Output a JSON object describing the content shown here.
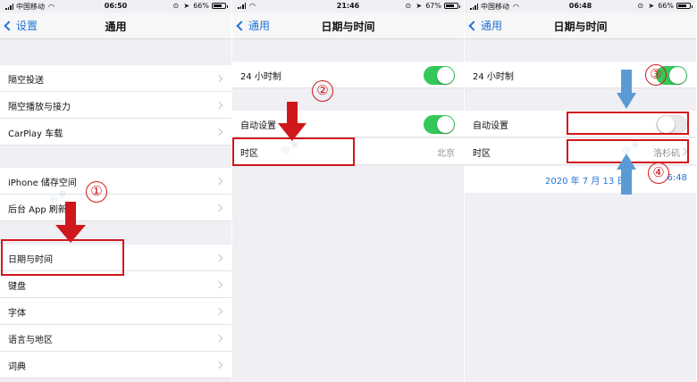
{
  "status_bars": [
    {
      "carrier": "中国移动",
      "time": "06:50",
      "battery": "66%",
      "battery_level": 0.66
    },
    {
      "carrier": "",
      "time": "21:46",
      "battery": "67%",
      "battery_level": 0.67
    },
    {
      "carrier": "中国移动",
      "time": "06:48",
      "battery": "66%",
      "battery_level": 0.66
    }
  ],
  "screen1": {
    "back_label": "设置",
    "title": "通用",
    "rows": [
      "隔空投送",
      "隔空播放与接力",
      "CarPlay 车载",
      "iPhone 储存空间",
      "后台 App 刷新",
      "日期与时间",
      "键盘",
      "字体",
      "语言与地区",
      "词典"
    ]
  },
  "screen2": {
    "back_label": "通用",
    "title": "日期与时间",
    "row_24h": "24 小时制",
    "toggle_24h_on": true,
    "row_auto": "自动设置",
    "toggle_auto_on": true,
    "row_tz": "时区",
    "tz_value": "北京"
  },
  "screen3": {
    "back_label": "通用",
    "title": "日期与时间",
    "row_24h": "24 小时制",
    "toggle_24h_on": true,
    "row_auto": "自动设置",
    "toggle_auto_on": false,
    "row_tz": "时区",
    "tz_value": "洛杉矶",
    "date": "2020 年 7 月 13 日",
    "time": "6:48"
  },
  "markers": {
    "step1": "①",
    "step2": "②",
    "step3": "③",
    "step4": "④"
  },
  "colors": {
    "accent_blue": "#1f73d8",
    "toggle_green": "#34c759",
    "annotation_red": "#d0181c",
    "arrow_blue": "#5b9bd5"
  },
  "icons": [
    "signal-icon",
    "wifi-icon",
    "alarm-icon",
    "battery-icon",
    "chevron-left-icon",
    "chevron-right-icon"
  ]
}
